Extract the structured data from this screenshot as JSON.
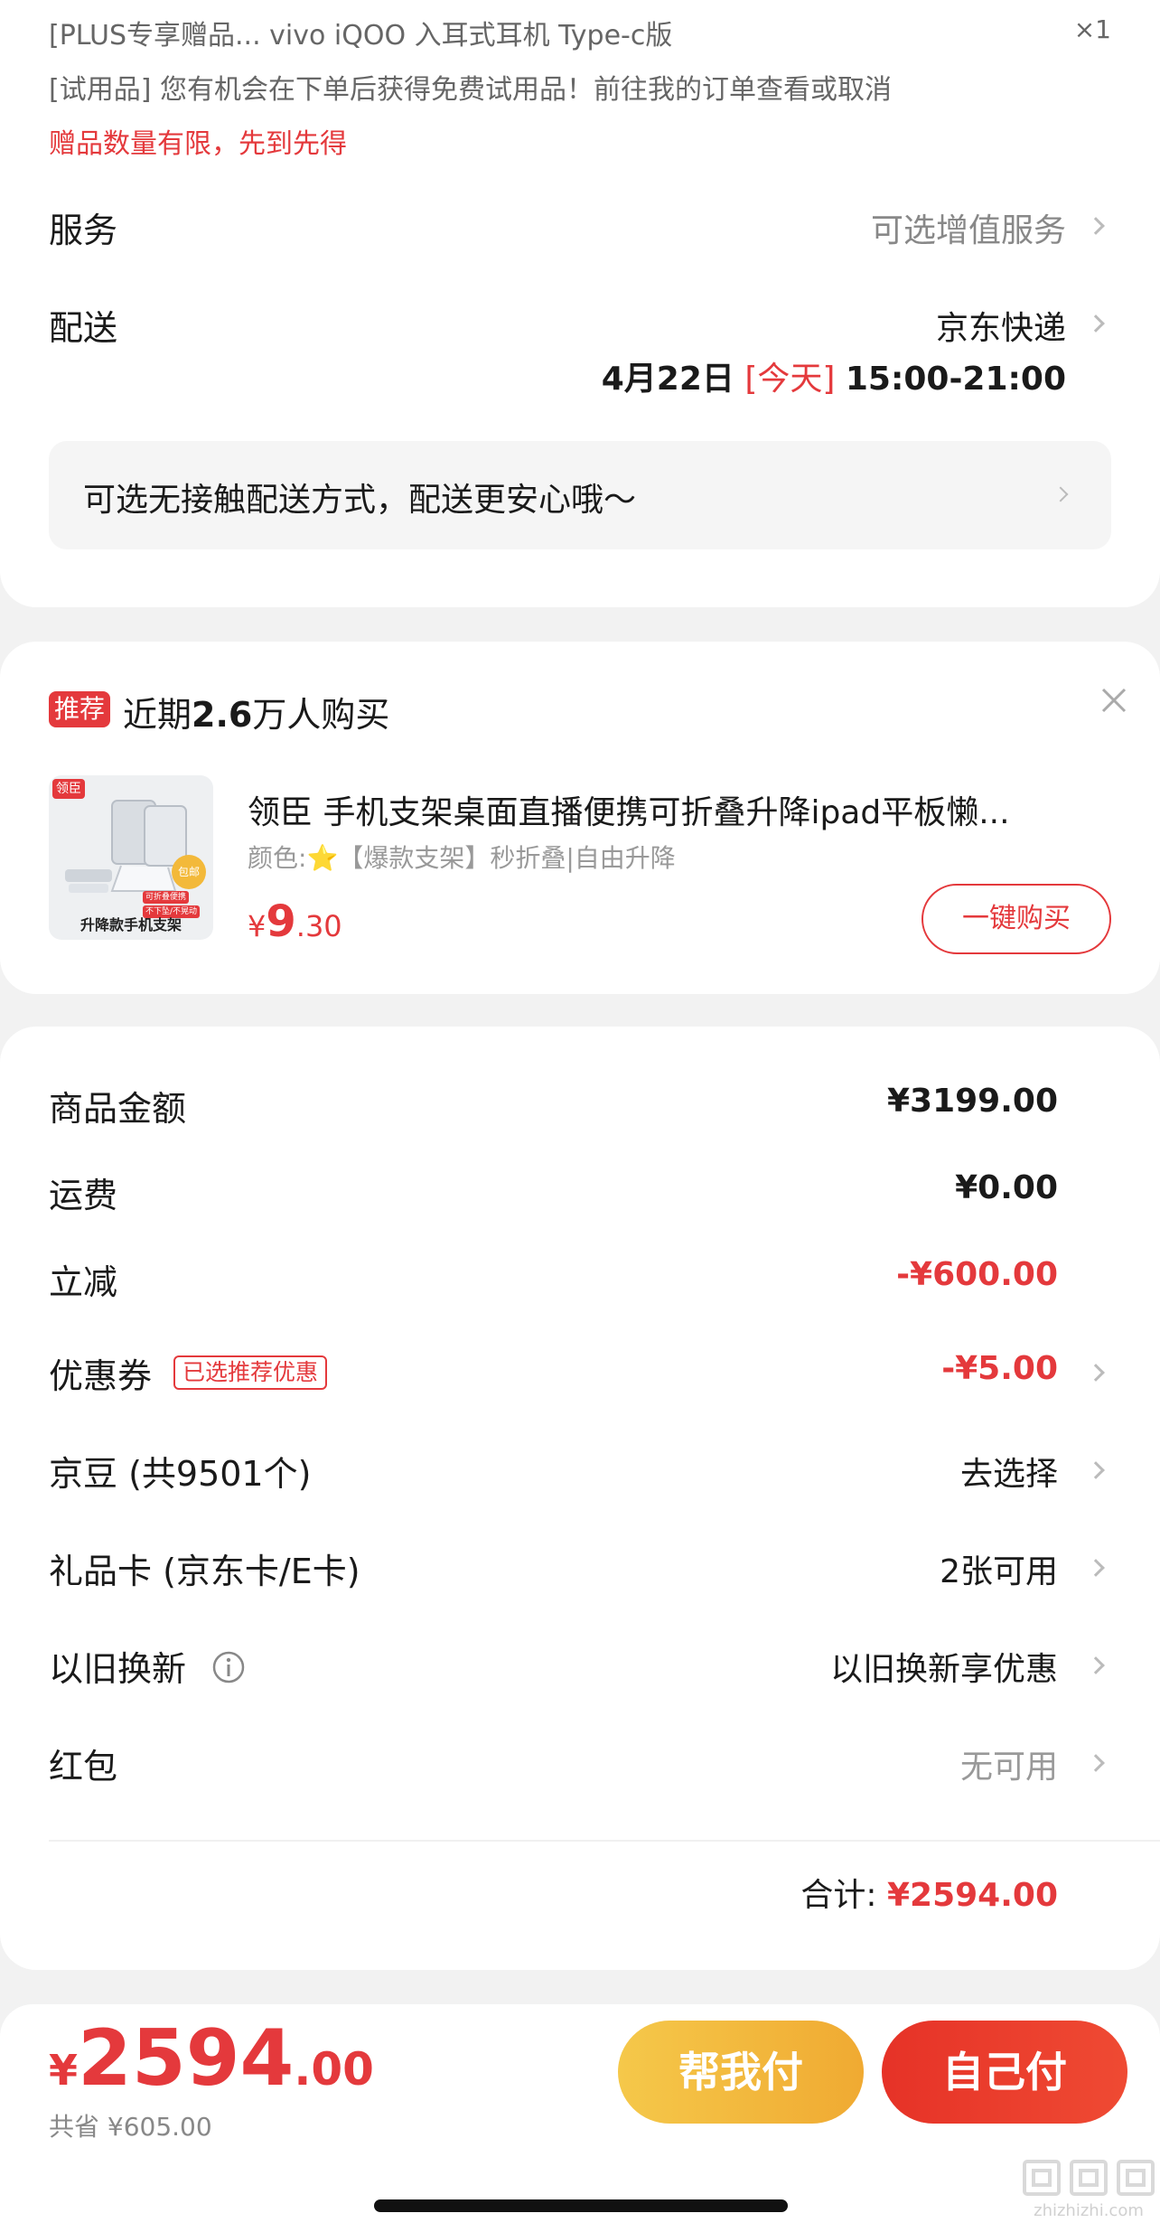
{
  "gift": {
    "line1": "[PLUS专享赠品...  vivo iQOO 入耳式耳机 Type-c版",
    "qty": "×1",
    "line2": "[试用品] 您有机会在下单后获得免费试用品！前往我的订单查看或取消",
    "line3": "赠品数量有限，先到先得"
  },
  "service": {
    "label": "服务",
    "value": "可选增值服务"
  },
  "delivery": {
    "label": "配送",
    "carrier": "京东快递",
    "date": "4月22日",
    "today": "[今天]",
    "time": "15:00-21:00",
    "contactless": "可选无接触配送方式，配送更安心哦～"
  },
  "recommend": {
    "badge": "推荐",
    "title_prefix": "近期",
    "title_num": "2.6",
    "title_suffix": "万人购买",
    "product": {
      "brand_tag": "领臣",
      "img_caption": "升降款手机支架",
      "img_badge": "包邮",
      "img_note1": "可折叠便携",
      "img_note2": "不下坠/不晃动",
      "name": "领臣 手机支架桌面直播便携可折叠升降ipad平板懒...",
      "spec_prefix": "颜色:",
      "spec_star": "⭐",
      "spec": "【爆款支架】秒折叠|自由升降",
      "price_symbol": "¥",
      "price_int": "9",
      "price_dec": ".30",
      "buy_button": "一键购买"
    }
  },
  "summary": {
    "rows": [
      {
        "label": "商品金额",
        "value": "¥3199.00"
      },
      {
        "label": "运费",
        "value": "¥0.00"
      },
      {
        "label": "立减",
        "value": "-¥600.00"
      },
      {
        "label": "优惠券",
        "tag": "已选推荐优惠",
        "value": "-¥5.00"
      },
      {
        "label": "京豆 (共9501个)",
        "value": "去选择"
      },
      {
        "label": "礼品卡 (京东卡/E卡)",
        "value": "2张可用"
      },
      {
        "label": "以旧换新",
        "value": "以旧换新享优惠"
      },
      {
        "label": "红包",
        "value": "无可用"
      }
    ],
    "total_label": "合计:",
    "total_value": "¥2594.00"
  },
  "footer": {
    "price_symbol": "¥",
    "price_int": "2594",
    "price_dec": ".00",
    "saved": "共省 ¥605.00",
    "help_pay": "帮我付",
    "self_pay": "自己付"
  },
  "watermark": {
    "text": "zhizhizhi.com"
  },
  "colors": {
    "accent_red": "#e4393c",
    "gold": "#f3b93a",
    "background": "#f2f2f2"
  }
}
